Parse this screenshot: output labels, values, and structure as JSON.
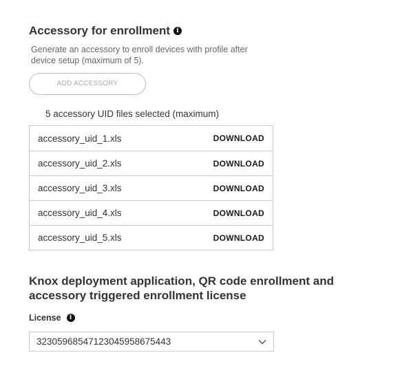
{
  "accessory": {
    "title": "Accessory for enrollment",
    "info_icon": "info-icon",
    "description": "Generate an accessory to enroll devices with profile after device setup (maximum of 5).",
    "add_button_label": "ADD ACCESSORY",
    "selected_note": "5 accessory UID files selected (maximum)",
    "files": [
      {
        "name": "accessory_uid_1.xls",
        "action": "DOWNLOAD"
      },
      {
        "name": "accessory_uid_2.xls",
        "action": "DOWNLOAD"
      },
      {
        "name": "accessory_uid_3.xls",
        "action": "DOWNLOAD"
      },
      {
        "name": "accessory_uid_4.xls",
        "action": "DOWNLOAD"
      },
      {
        "name": "accessory_uid_5.xls",
        "action": "DOWNLOAD"
      }
    ]
  },
  "license": {
    "title": "Knox deployment application, QR code enrollment and accessory triggered enrollment license",
    "label": "License",
    "info_icon": "info-icon",
    "selected_value": "3230596854712304595867544​3",
    "dropdown_icon": "chevron-down-icon"
  }
}
